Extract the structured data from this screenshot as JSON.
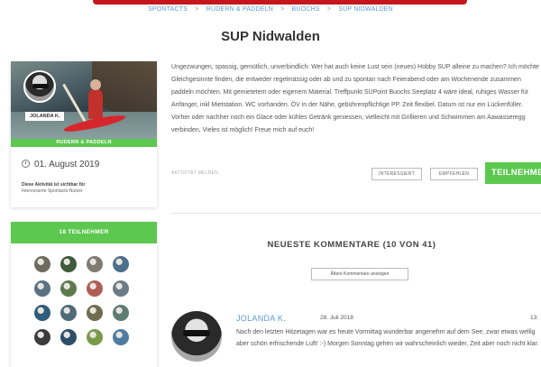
{
  "breadcrumb": [
    "SPONTACTS",
    "RUDERN & PADDELN",
    "BUOCHS",
    "SUP NIDWALDEN"
  ],
  "breadcrumb_sep": ">",
  "title": "SUP Nidwalden",
  "profile": {
    "user_label": "JOLANDA K.",
    "category": "RUDERN & PADDELN",
    "date": "01. August 2019",
    "visibility_line1": "Diese Aktivität ist sichtbar für",
    "visibility_line2": "Interessierte Spontacts-Nutzer"
  },
  "participants": {
    "header": "18 TEILNEHMER",
    "avatar_colors": [
      "#6d6a5e",
      "#3e5a3a",
      "#7f7a72",
      "#4e6f8a",
      "#5a7182",
      "#5d7a4d",
      "#b05d57",
      "#6b7c86",
      "#2f5d7c",
      "#4f6b78",
      "#6f6d4d",
      "#5e7c74",
      "#3c3c3c",
      "#2e4f6a",
      "#7a9a4a",
      "#4e7ca0"
    ]
  },
  "description": "Ungezwungen, spassig, gemütlich, unverbindlich: Wer hat auch keine Lust sein (neues) Hobby SUP alleine zu machen? Ich möchte Gleichgesinnte finden, die entweder regelmässig oder ab und zu spontan nach Feierabend oder am Wochenende zusammen paddeln möchten. Mit gemietetem oder eigenem Material. Treffpunkt SUPoint Buochs Seeplatz 4 wäre ideal, ruhiges Wasser für Anfänger, inkl Mietstation. WC vorhanden. ÖV in der Nähe, gebührenpflichtige PP. Zeit flexibel. Datum ist nur ein Lückenfüller. Vorher oder nachher noch ein Glace oder kühles Getränk geniessen, vielleicht mit Grillieren und Schwimmen am Aawasseregg verbinden, Vieles ist möglich! Freue mich auf euch!",
  "actions": {
    "report": "AKTIVITÄT MELDEN",
    "interested": "INTERESSIERT",
    "recommend": "EMPFEHLEN",
    "join": "TEILNEHMEN"
  },
  "comments": {
    "title": "NEUESTE KOMMENTARE (10 VON 41)",
    "older": "Ältere Kommentare anzeigen",
    "first": {
      "author": "JOLANDA K.",
      "date": "28. Juli 2018",
      "time": "13:",
      "text": "Nach den letzten Hitzetagen war es heute Vormittag wunderbar angenehm auf dem See, zwar etwas wellig aber schön erfrischende Luft! :-) Morgen Sonntag gehen wir wahrscheinlich wieder, Zeit aber noch nicht klar."
    }
  }
}
